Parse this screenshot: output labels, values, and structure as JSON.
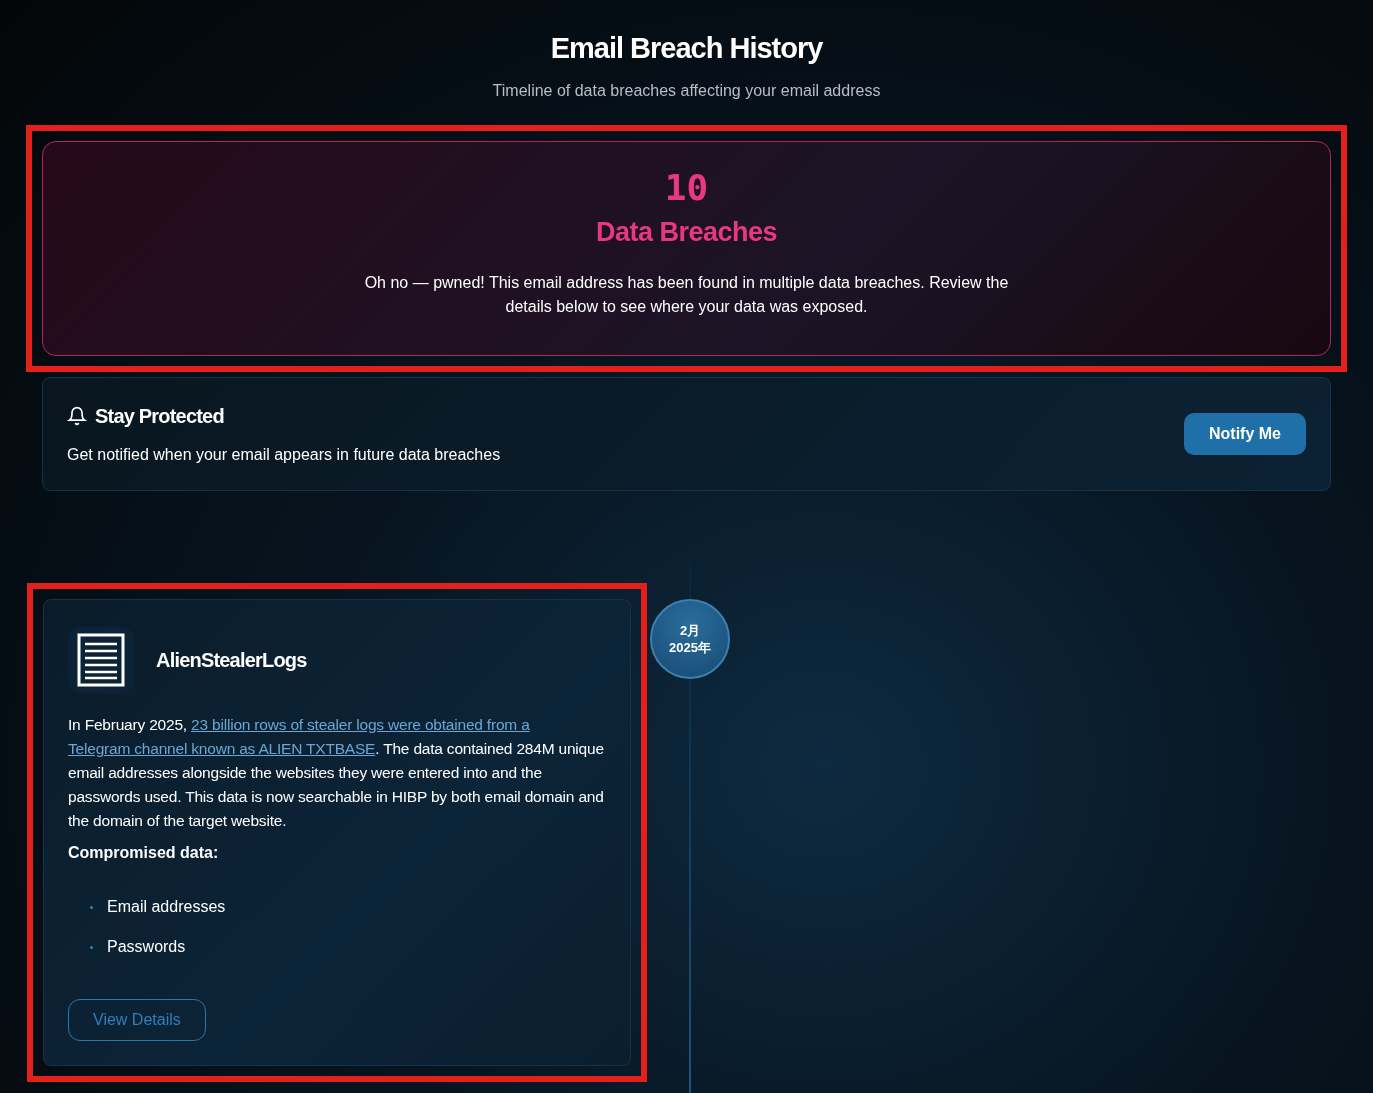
{
  "header": {
    "title": "Email Breach History",
    "subtitle": "Timeline of data breaches affecting your email address"
  },
  "summary": {
    "highlighted": true,
    "count": "10",
    "label": "Data Breaches",
    "message": "Oh no — pwned! This email address has been found in multiple data breaches. Review the details below to see where your data was exposed."
  },
  "notify": {
    "title": "Stay Protected",
    "text": "Get notified when your email appears in future data breaches",
    "button": "Notify Me"
  },
  "breaches": [
    {
      "highlighted": true,
      "name": "AlienStealerLogs",
      "date_month": "2月",
      "date_year": "2025年",
      "description_before": "In February 2025, ",
      "description_link_lines": [
        "23 billion rows of stealer logs were obtained from a",
        "Telegram channel known as ALIEN TXTBASE"
      ],
      "description_after": ". The data contained 284M unique email addresses alongside the websites they were entered into and the passwords used. This data is now searchable in HIBP by both email domain and the domain of the target website.",
      "data_heading": "Compromised data:",
      "data_classes": [
        "Email addresses",
        "Passwords"
      ],
      "button": "View Details"
    }
  ]
}
